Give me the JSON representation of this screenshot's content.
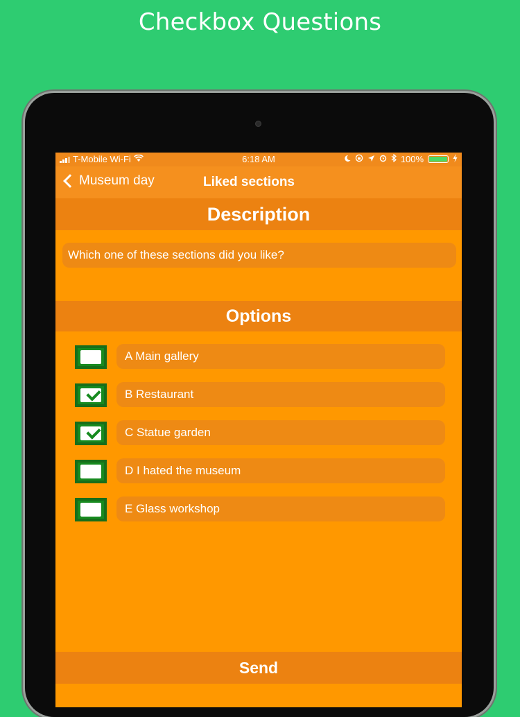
{
  "promo": {
    "title": "Checkbox Questions"
  },
  "status_bar": {
    "carrier": "T-Mobile Wi-Fi",
    "time": "6:18 AM",
    "battery": "100%",
    "icons": [
      "wifi-icon",
      "moon-icon",
      "lock-rotation-icon",
      "location-icon",
      "alarm-icon",
      "bluetooth-icon",
      "charging-icon"
    ]
  },
  "nav": {
    "back_label": "Museum day",
    "title": "Liked sections"
  },
  "description": {
    "header": "Description",
    "question": "Which one of these sections did you like?"
  },
  "options": {
    "header": "Options",
    "items": [
      {
        "label": "A Main gallery",
        "checked": false
      },
      {
        "label": "B Restaurant",
        "checked": true
      },
      {
        "label": "C Statue garden",
        "checked": true
      },
      {
        "label": "D I hated the museum",
        "checked": false
      },
      {
        "label": "E Glass workshop",
        "checked": false
      }
    ]
  },
  "send": {
    "label": "Send"
  },
  "colors": {
    "background": "#2ecc71",
    "screen": "#ff9800",
    "header": "#ec8211",
    "checkbox": "#178a1f"
  }
}
